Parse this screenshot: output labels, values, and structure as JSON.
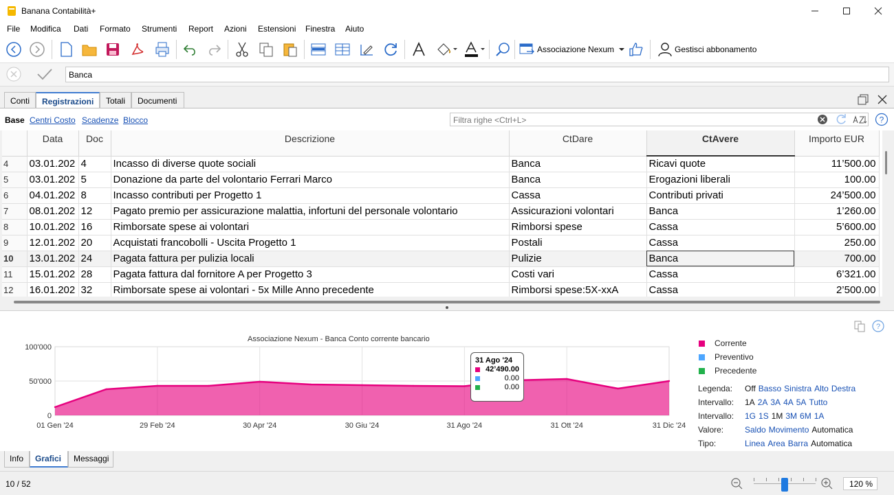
{
  "window": {
    "title": "Banana Contabilità+"
  },
  "menu": [
    "File",
    "Modifica",
    "Dati",
    "Formato",
    "Strumenti",
    "Report",
    "Azioni",
    "Estensioni",
    "Finestra",
    "Aiuto"
  ],
  "toolbar": {
    "company_label": "Associazione Nexum",
    "account_label": "Gestisci abbonamento"
  },
  "edit_row": {
    "value": "Banca"
  },
  "tabs": [
    "Conti",
    "Registrazioni",
    "Totali",
    "Documenti"
  ],
  "views": {
    "base": "Base",
    "links": [
      "Centri Costo",
      "Scadenze",
      "Blocco"
    ]
  },
  "filter": {
    "placeholder": "Filtra righe <Ctrl+L>"
  },
  "table": {
    "columns": [
      "",
      "Data",
      "Doc",
      "Descrizione",
      "CtDare",
      "CtAvere",
      "Importo EUR"
    ],
    "rows": [
      {
        "n": "4",
        "date": "03.01.202",
        "doc": "4",
        "desc": "Incasso di diverse quote sociali",
        "dare": "Banca",
        "avere": "Ricavi quote",
        "amount": "11’500.00"
      },
      {
        "n": "5",
        "date": "03.01.202",
        "doc": "5",
        "desc": "Donazione da parte del volontario Ferrari Marco",
        "dare": "Banca",
        "avere": "Erogazioni liberali",
        "amount": "100.00"
      },
      {
        "n": "6",
        "date": "04.01.202",
        "doc": "8",
        "desc": "Incasso contributi per Progetto 1",
        "dare": "Cassa",
        "avere": "Contributi privati",
        "amount": "24’500.00"
      },
      {
        "n": "7",
        "date": "08.01.202",
        "doc": "12",
        "desc": "Pagato premio per assicurazione malattia, infortuni del personale volontario",
        "dare": "Assicurazioni volontari",
        "avere": "Banca",
        "amount": "1’260.00"
      },
      {
        "n": "8",
        "date": "10.01.202",
        "doc": "16",
        "desc": "Rimborsate spese ai volontari",
        "dare": "Rimborsi spese",
        "avere": "Cassa",
        "amount": "5’600.00"
      },
      {
        "n": "9",
        "date": "12.01.202",
        "doc": "20",
        "desc": "Acquistati francobolli - Uscita Progetto 1",
        "dare": "Postali",
        "avere": "Cassa",
        "amount": "250.00"
      },
      {
        "n": "10",
        "date": "13.01.202",
        "doc": "24",
        "desc": "Pagata fattura per pulizia locali",
        "dare": "Pulizie",
        "avere": "Banca",
        "amount": "700.00"
      },
      {
        "n": "11",
        "date": "15.01.202",
        "doc": "28",
        "desc": "Pagata fattura dal fornitore A per Progetto 3",
        "dare": "Costi vari",
        "avere": "Cassa",
        "amount": "6’321.00"
      },
      {
        "n": "12",
        "date": "16.01.202",
        "doc": "32",
        "desc": "Rimborsate spese ai volontari - 5x Mille Anno precedente",
        "dare": "Rimborsi spese:5X-xxA",
        "avere": "Cassa",
        "amount": "2’500.00"
      }
    ]
  },
  "chart_data": {
    "type": "area",
    "title": "Associazione Nexum - Banca Conto corrente bancario",
    "x_ticks": [
      "01 Gen '24",
      "29 Feb '24",
      "30 Apr '24",
      "30 Giu '24",
      "31 Ago '24",
      "31 Ott '24",
      "31 Dic '24"
    ],
    "y_ticks": [
      "100'000",
      "50'000",
      "0"
    ],
    "ylim": [
      0,
      100000
    ],
    "series": [
      {
        "name": "Corrente",
        "color": "#e6007e",
        "x": [
          "01 Gen '24",
          "31 Gen '24",
          "29 Feb '24",
          "31 Mar '24",
          "30 Apr '24",
          "31 Mag '24",
          "30 Giu '24",
          "31 Lug '24",
          "31 Ago '24",
          "30 Set '24",
          "31 Ott '24",
          "30 Nov '24",
          "31 Dic '24"
        ],
        "values": [
          12000,
          38000,
          43000,
          43000,
          49000,
          45000,
          44000,
          43000,
          42490,
          51000,
          53000,
          39000,
          50000
        ]
      },
      {
        "name": "Preventivo",
        "color": "#4da6ff",
        "values": []
      },
      {
        "name": "Precedente",
        "color": "#22b14c",
        "values": []
      }
    ],
    "tooltip": {
      "date": "31 Ago '24",
      "values": [
        "42’490.00",
        "0.00",
        "0.00"
      ]
    },
    "grid": true,
    "legend": "right"
  },
  "chart_options": {
    "legenda": {
      "label": "Legenda:",
      "plain": "Off",
      "links": [
        "Basso",
        "Sinistra",
        "Alto",
        "Destra"
      ]
    },
    "intervallo1": {
      "label": "Intervallo:",
      "items": [
        "1A",
        "2A",
        "3A",
        "4A",
        "5A",
        "Tutto"
      ]
    },
    "intervallo2": {
      "label": "Intervallo:",
      "items": [
        "1G",
        "1S",
        "1M",
        "3M",
        "6M",
        "1A"
      ]
    },
    "valore": {
      "label": "Valore:",
      "links": [
        "Saldo",
        "Movimento"
      ],
      "plain": "Automatica"
    },
    "tipo": {
      "label": "Tipo:",
      "links": [
        "Linea",
        "Area",
        "Barra"
      ],
      "plain": "Automatica"
    }
  },
  "bottom_tabs": [
    "Info",
    "Grafici",
    "Messaggi"
  ],
  "status": {
    "position": "10 / 52",
    "zoom": "120 %"
  }
}
